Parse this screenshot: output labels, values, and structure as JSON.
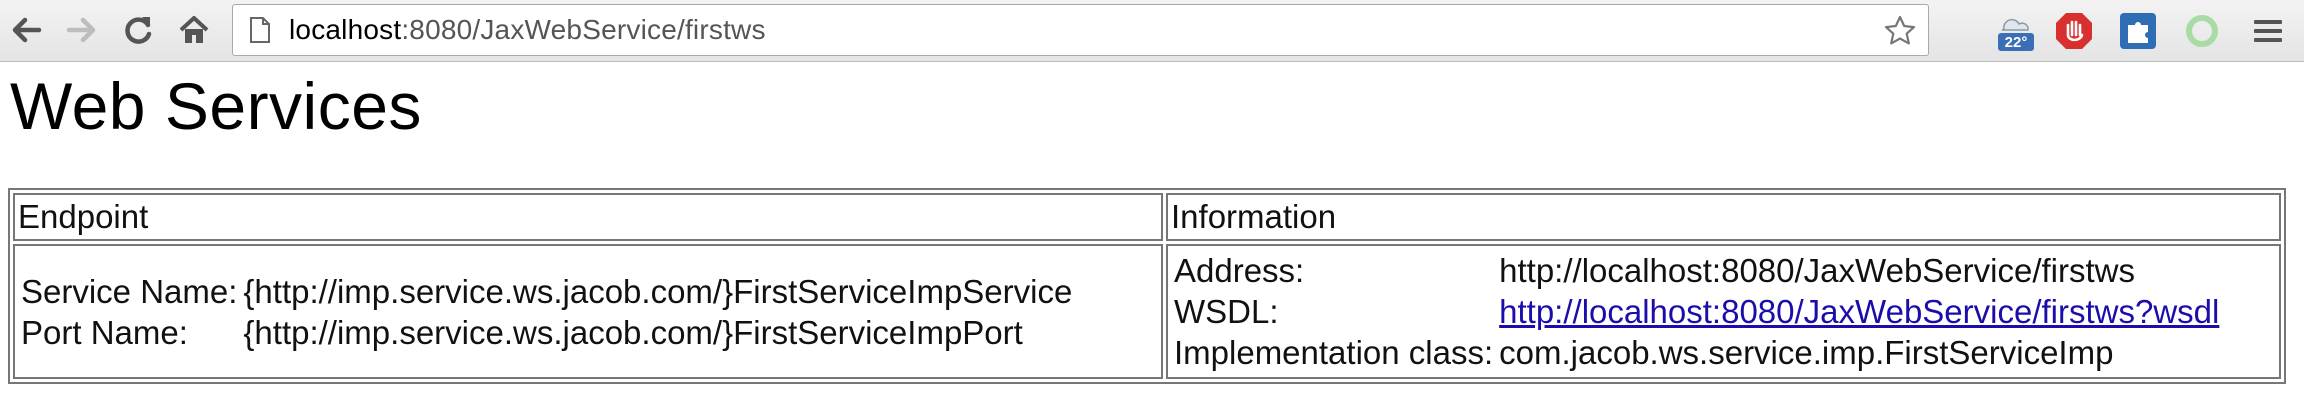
{
  "browser": {
    "url_host": "localhost",
    "url_rest": ":8080/JaxWebService/firstws",
    "weather_temp": "22°"
  },
  "page": {
    "title": "Web Services",
    "headers": {
      "endpoint": "Endpoint",
      "information": "Information"
    },
    "endpoint": {
      "service_name_label": "Service Name:",
      "service_name_value": "{http://imp.service.ws.jacob.com/}FirstServiceImpService",
      "port_name_label": "Port Name:",
      "port_name_value": "{http://imp.service.ws.jacob.com/}FirstServiceImpPort"
    },
    "information": {
      "address_label": "Address:",
      "address_value": "http://localhost:8080/JaxWebService/firstws",
      "wsdl_label": "WSDL:",
      "wsdl_value": "http://localhost:8080/JaxWebService/firstws?wsdl",
      "impl_label": "Implementation class:",
      "impl_value": "com.jacob.ws.service.imp.FirstServiceImp"
    }
  },
  "colors": {
    "link": "#1a0dab",
    "toolbar": "#e8e8e8",
    "border": "#777777"
  }
}
